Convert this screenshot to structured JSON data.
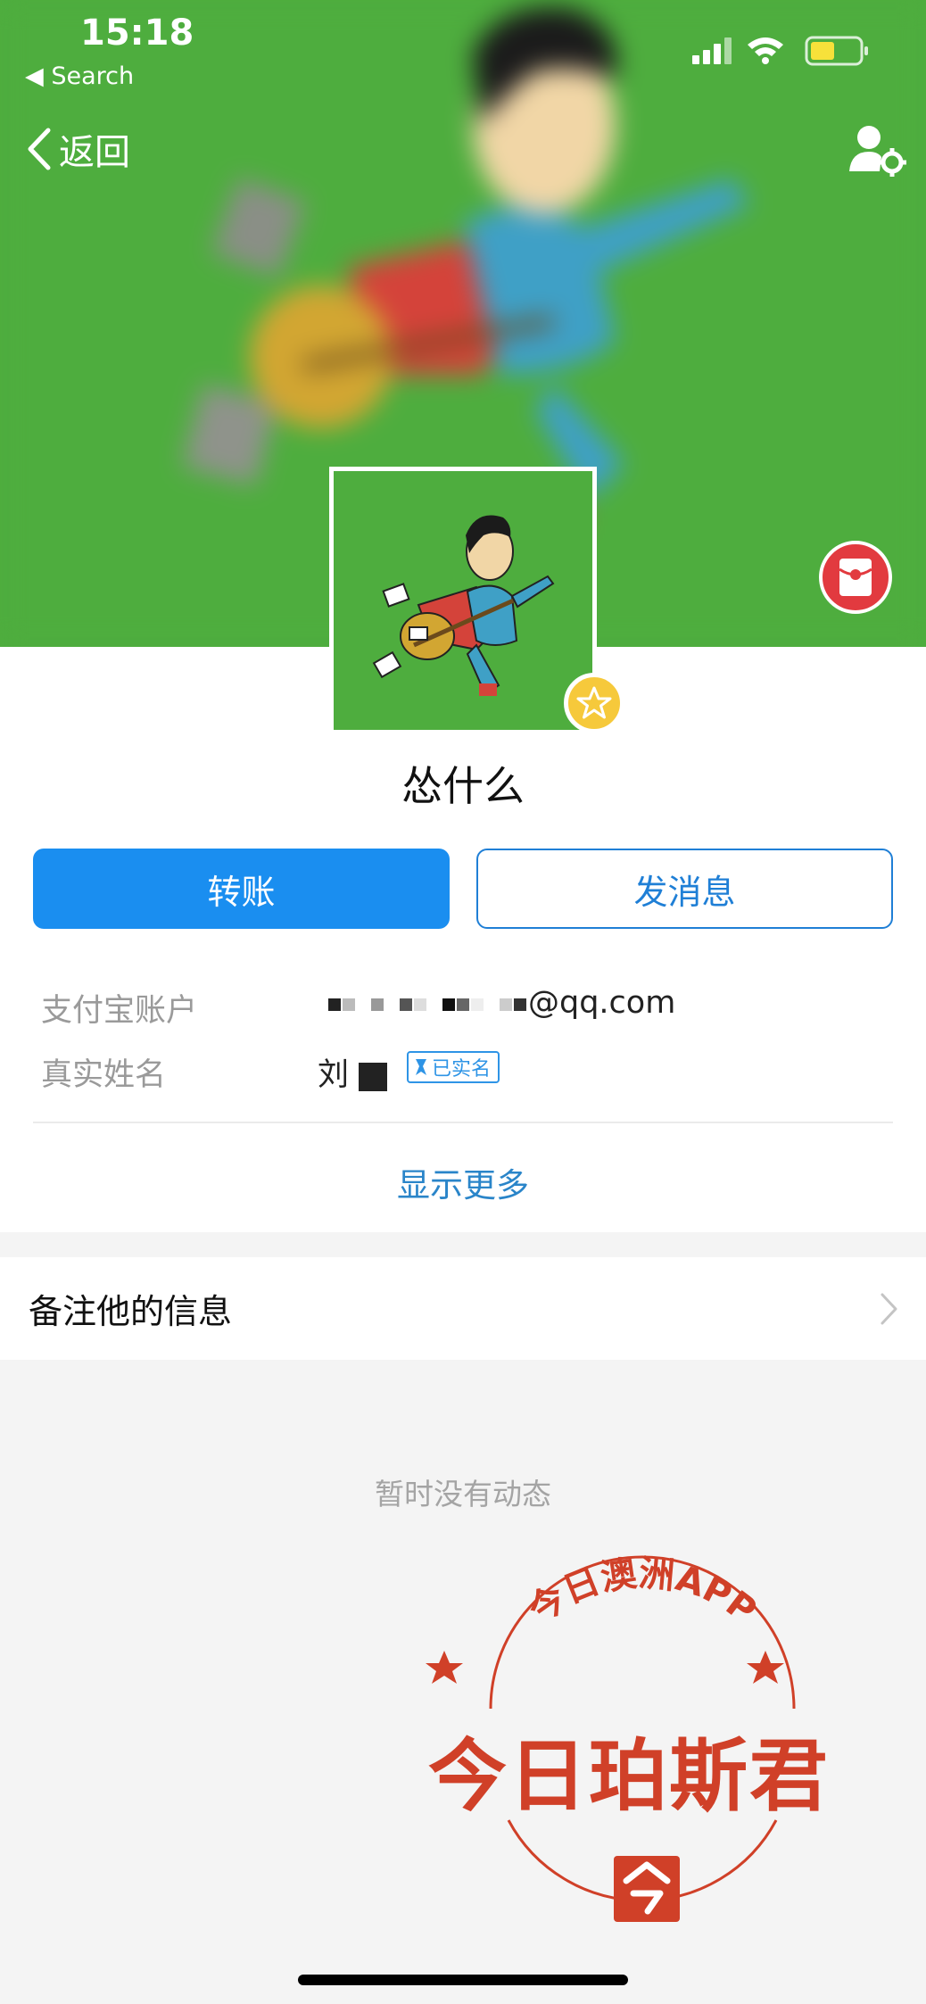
{
  "status_bar": {
    "time": "15:18",
    "back_app": "◀ Search"
  },
  "nav": {
    "back_label": "返回"
  },
  "profile": {
    "nickname": "怂什么"
  },
  "actions": {
    "transfer_label": "转账",
    "message_label": "发消息"
  },
  "info": {
    "account_label": "支付宝账户",
    "account_value_suffix": "@qq.com",
    "realname_label": "真实姓名",
    "realname_value": "刘",
    "verified_label": "已实名"
  },
  "show_more": "显示更多",
  "remark_label": "备注他的信息",
  "empty_feed": "暂时没有动态",
  "watermark": {
    "arc_text": "今日澳洲APP",
    "main_text": "今日珀斯君"
  },
  "colors": {
    "cover_green": "#4ead3e",
    "primary_blue": "#1a8ef0",
    "link_blue": "#2a85c9",
    "red": "#e23a3f"
  }
}
